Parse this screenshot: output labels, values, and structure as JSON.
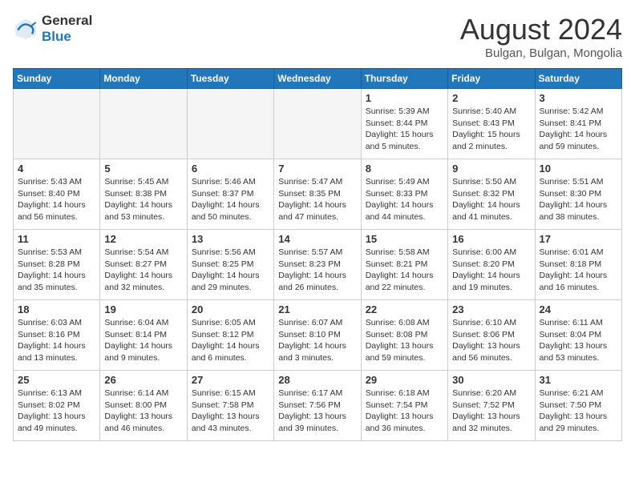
{
  "header": {
    "logo_general": "General",
    "logo_blue": "Blue",
    "month_year": "August 2024",
    "location": "Bulgan, Bulgan, Mongolia"
  },
  "days_of_week": [
    "Sunday",
    "Monday",
    "Tuesday",
    "Wednesday",
    "Thursday",
    "Friday",
    "Saturday"
  ],
  "weeks": [
    [
      {
        "date": "",
        "info": ""
      },
      {
        "date": "",
        "info": ""
      },
      {
        "date": "",
        "info": ""
      },
      {
        "date": "",
        "info": ""
      },
      {
        "date": "1",
        "info": "Sunrise: 5:39 AM\nSunset: 8:44 PM\nDaylight: 15 hours\nand 5 minutes."
      },
      {
        "date": "2",
        "info": "Sunrise: 5:40 AM\nSunset: 8:43 PM\nDaylight: 15 hours\nand 2 minutes."
      },
      {
        "date": "3",
        "info": "Sunrise: 5:42 AM\nSunset: 8:41 PM\nDaylight: 14 hours\nand 59 minutes."
      }
    ],
    [
      {
        "date": "4",
        "info": "Sunrise: 5:43 AM\nSunset: 8:40 PM\nDaylight: 14 hours\nand 56 minutes."
      },
      {
        "date": "5",
        "info": "Sunrise: 5:45 AM\nSunset: 8:38 PM\nDaylight: 14 hours\nand 53 minutes."
      },
      {
        "date": "6",
        "info": "Sunrise: 5:46 AM\nSunset: 8:37 PM\nDaylight: 14 hours\nand 50 minutes."
      },
      {
        "date": "7",
        "info": "Sunrise: 5:47 AM\nSunset: 8:35 PM\nDaylight: 14 hours\nand 47 minutes."
      },
      {
        "date": "8",
        "info": "Sunrise: 5:49 AM\nSunset: 8:33 PM\nDaylight: 14 hours\nand 44 minutes."
      },
      {
        "date": "9",
        "info": "Sunrise: 5:50 AM\nSunset: 8:32 PM\nDaylight: 14 hours\nand 41 minutes."
      },
      {
        "date": "10",
        "info": "Sunrise: 5:51 AM\nSunset: 8:30 PM\nDaylight: 14 hours\nand 38 minutes."
      }
    ],
    [
      {
        "date": "11",
        "info": "Sunrise: 5:53 AM\nSunset: 8:28 PM\nDaylight: 14 hours\nand 35 minutes."
      },
      {
        "date": "12",
        "info": "Sunrise: 5:54 AM\nSunset: 8:27 PM\nDaylight: 14 hours\nand 32 minutes."
      },
      {
        "date": "13",
        "info": "Sunrise: 5:56 AM\nSunset: 8:25 PM\nDaylight: 14 hours\nand 29 minutes."
      },
      {
        "date": "14",
        "info": "Sunrise: 5:57 AM\nSunset: 8:23 PM\nDaylight: 14 hours\nand 26 minutes."
      },
      {
        "date": "15",
        "info": "Sunrise: 5:58 AM\nSunset: 8:21 PM\nDaylight: 14 hours\nand 22 minutes."
      },
      {
        "date": "16",
        "info": "Sunrise: 6:00 AM\nSunset: 8:20 PM\nDaylight: 14 hours\nand 19 minutes."
      },
      {
        "date": "17",
        "info": "Sunrise: 6:01 AM\nSunset: 8:18 PM\nDaylight: 14 hours\nand 16 minutes."
      }
    ],
    [
      {
        "date": "18",
        "info": "Sunrise: 6:03 AM\nSunset: 8:16 PM\nDaylight: 14 hours\nand 13 minutes."
      },
      {
        "date": "19",
        "info": "Sunrise: 6:04 AM\nSunset: 8:14 PM\nDaylight: 14 hours\nand 9 minutes."
      },
      {
        "date": "20",
        "info": "Sunrise: 6:05 AM\nSunset: 8:12 PM\nDaylight: 14 hours\nand 6 minutes."
      },
      {
        "date": "21",
        "info": "Sunrise: 6:07 AM\nSunset: 8:10 PM\nDaylight: 14 hours\nand 3 minutes."
      },
      {
        "date": "22",
        "info": "Sunrise: 6:08 AM\nSunset: 8:08 PM\nDaylight: 13 hours\nand 59 minutes."
      },
      {
        "date": "23",
        "info": "Sunrise: 6:10 AM\nSunset: 8:06 PM\nDaylight: 13 hours\nand 56 minutes."
      },
      {
        "date": "24",
        "info": "Sunrise: 6:11 AM\nSunset: 8:04 PM\nDaylight: 13 hours\nand 53 minutes."
      }
    ],
    [
      {
        "date": "25",
        "info": "Sunrise: 6:13 AM\nSunset: 8:02 PM\nDaylight: 13 hours\nand 49 minutes."
      },
      {
        "date": "26",
        "info": "Sunrise: 6:14 AM\nSunset: 8:00 PM\nDaylight: 13 hours\nand 46 minutes."
      },
      {
        "date": "27",
        "info": "Sunrise: 6:15 AM\nSunset: 7:58 PM\nDaylight: 13 hours\nand 43 minutes."
      },
      {
        "date": "28",
        "info": "Sunrise: 6:17 AM\nSunset: 7:56 PM\nDaylight: 13 hours\nand 39 minutes."
      },
      {
        "date": "29",
        "info": "Sunrise: 6:18 AM\nSunset: 7:54 PM\nDaylight: 13 hours\nand 36 minutes."
      },
      {
        "date": "30",
        "info": "Sunrise: 6:20 AM\nSunset: 7:52 PM\nDaylight: 13 hours\nand 32 minutes."
      },
      {
        "date": "31",
        "info": "Sunrise: 6:21 AM\nSunset: 7:50 PM\nDaylight: 13 hours\nand 29 minutes."
      }
    ]
  ]
}
